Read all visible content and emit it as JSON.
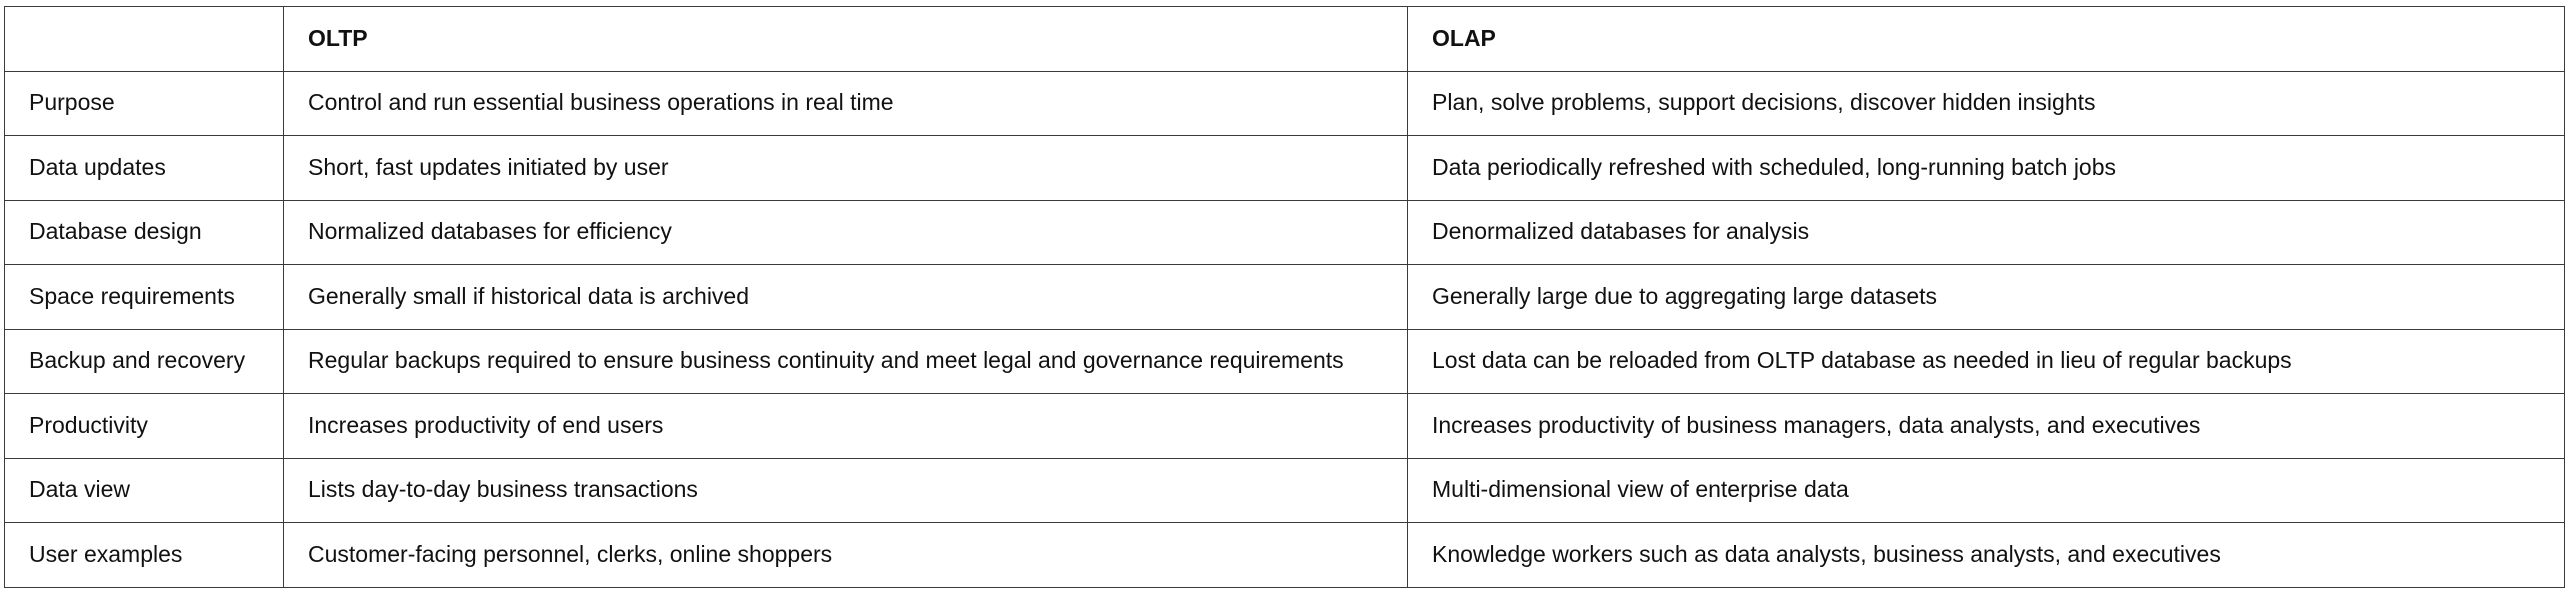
{
  "table": {
    "headers": [
      "",
      "OLTP",
      "OLAP"
    ],
    "rows": [
      [
        "Purpose",
        "Control and run essential business operations in real time",
        "Plan, solve problems, support decisions, discover hidden insights"
      ],
      [
        "Data updates",
        "Short, fast updates initiated by user",
        "Data periodically refreshed with scheduled, long-running batch jobs"
      ],
      [
        "Database design",
        "Normalized databases for efficiency",
        "Denormalized databases for analysis"
      ],
      [
        "Space requirements",
        "Generally small if historical data is archived",
        "Generally large due to aggregating large datasets"
      ],
      [
        "Backup and recovery",
        "Regular backups required to ensure business continuity and meet legal and governance requirements",
        "Lost data can be reloaded from OLTP database as needed in lieu of regular backups"
      ],
      [
        "Productivity",
        "Increases productivity of end users",
        "Increases productivity of business managers, data analysts, and executives"
      ],
      [
        "Data view",
        "Lists day-to-day business transactions",
        "Multi-dimensional view of enterprise data"
      ],
      [
        "User examples",
        "Customer-facing personnel, clerks, online shoppers",
        "Knowledge workers such as data analysts, business analysts, and executives"
      ]
    ]
  }
}
